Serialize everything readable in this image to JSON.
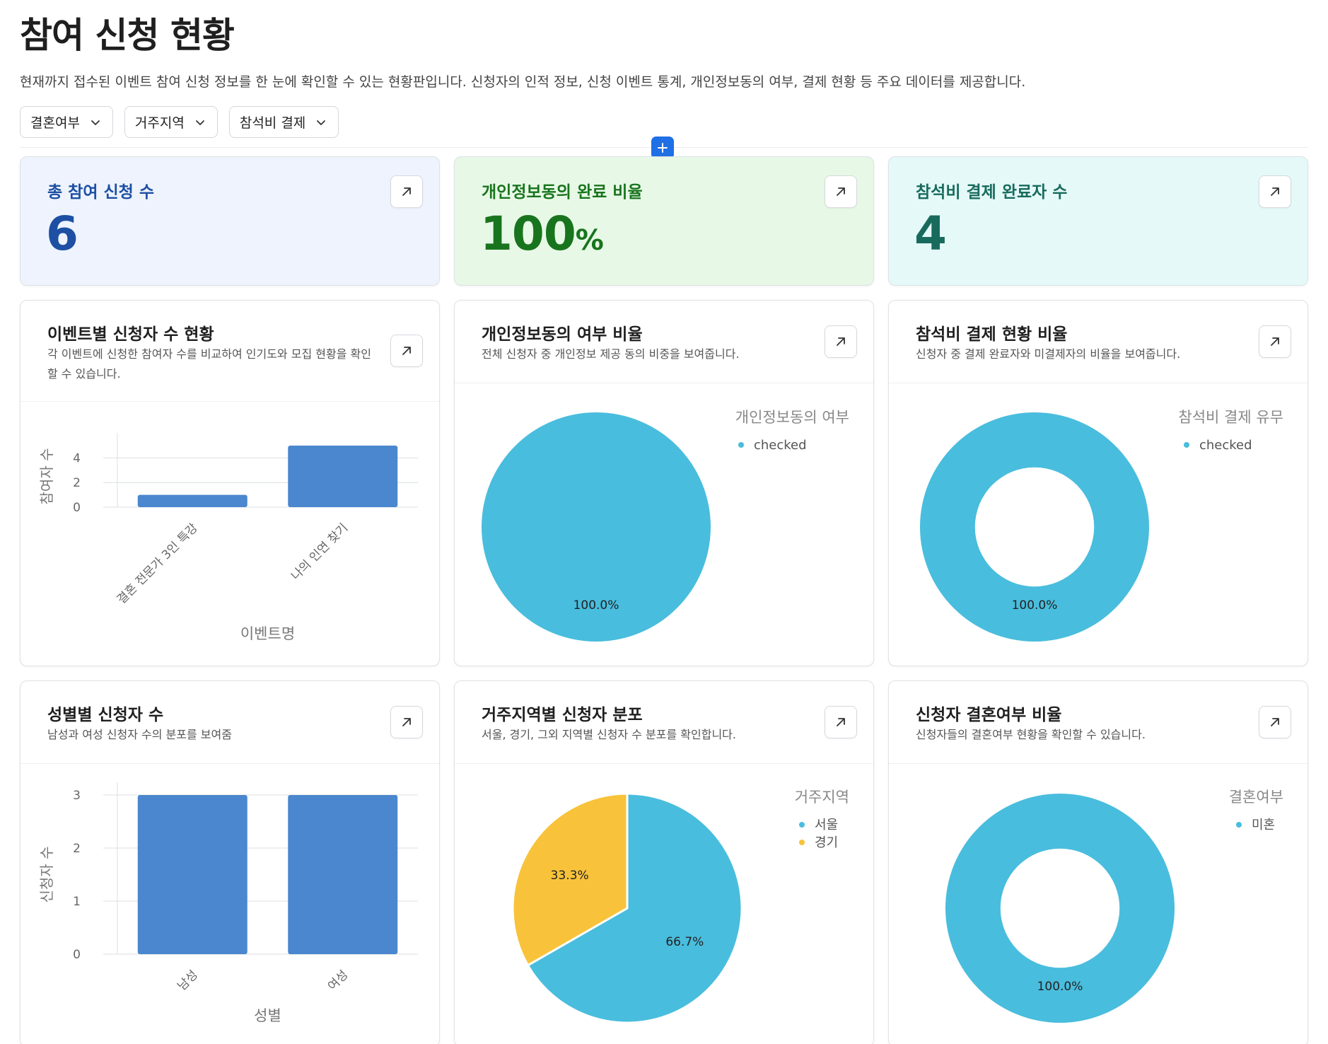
{
  "page": {
    "title": "참여 신청 현황",
    "description": "현재까지 접수된 이벤트 참여 신청 정보를 한 눈에 확인할 수 있는 현황판입니다. 신청자의 인적 정보, 신청 이벤트 통계, 개인정보동의 여부, 결제 현황 등 주요 데이터를 제공합니다."
  },
  "filters": [
    {
      "label": "결혼여부"
    },
    {
      "label": "거주지역"
    },
    {
      "label": "참석비 결제"
    }
  ],
  "add_button": {
    "label": "+"
  },
  "kpis": [
    {
      "title": "총 참여 신청 수",
      "value": "6",
      "unit": "",
      "color": "#1d4fa3",
      "bg": "#eef3fd"
    },
    {
      "title": "개인정보동의 완료 비율",
      "value": "100",
      "unit": "%",
      "color": "#19741e",
      "bg": "#e7f9e6"
    },
    {
      "title": "참석비 결제 완료자 수",
      "value": "4",
      "unit": "",
      "color": "#186b5c",
      "bg": "#e5f9f9"
    }
  ],
  "cards": {
    "events": {
      "title": "이벤트별 신청자 수 현황",
      "subtitle_line1": "각 이벤트에 신청한 참여자 수를 비교하여 인기도와 모집 현황을 확인",
      "subtitle_line2": "할 수 있습니다."
    },
    "privacy": {
      "title": "개인정보동의 여부 비율",
      "subtitle": "전체 신청자 중 개인정보 제공 동의 비중을 보여줍니다."
    },
    "payment": {
      "title": "참석비 결제 현황 비율",
      "subtitle": "신청자 중 결제 완료자와 미결제자의 비율을 보여줍니다."
    },
    "gender": {
      "title": "성별별 신청자 수",
      "subtitle": "남성과 여성 신청자 수의 분포를 보여줌"
    },
    "region": {
      "title": "거주지역별 신청자 분포",
      "subtitle": "서울, 경기, 그외 지역별 신청자 수 분포를 확인합니다."
    },
    "marital": {
      "title": "신청자 결혼여부 비율",
      "subtitle": "신청자들의 결혼여부 현황을 확인할 수 있습니다."
    }
  },
  "chart_data": [
    {
      "type": "bar",
      "id": "events",
      "categories": [
        "결혼 전문가 3인 특강",
        "나의 인연 찾기"
      ],
      "values": [
        1,
        5
      ],
      "ylabel": "참여자 수",
      "xlabel": "이벤트명",
      "ylim": [
        0,
        5
      ],
      "yticks": [
        0,
        2,
        4
      ],
      "color": "#4a87ce",
      "grid": true
    },
    {
      "type": "pie",
      "id": "privacy",
      "legend_title": "개인정보동의 여부",
      "labels": [
        "checked"
      ],
      "values": [
        100
      ],
      "percent_labels": [
        "100.0%"
      ],
      "colors": [
        "#49bddd"
      ],
      "legend": "top-right"
    },
    {
      "type": "pie",
      "id": "payment",
      "donut": true,
      "legend_title": "참석비 결제 유무",
      "labels": [
        "checked"
      ],
      "values": [
        100
      ],
      "percent_labels": [
        "100.0%"
      ],
      "colors": [
        "#49bddd"
      ],
      "legend": "top-right"
    },
    {
      "type": "bar",
      "id": "gender",
      "categories": [
        "남성",
        "여성"
      ],
      "values": [
        3,
        3
      ],
      "ylabel": "신청자 수",
      "xlabel": "성별",
      "ylim": [
        0,
        3
      ],
      "yticks": [
        0,
        1,
        2,
        3
      ],
      "color": "#4a87ce",
      "grid": true
    },
    {
      "type": "pie",
      "id": "region",
      "legend_title": "거주지역",
      "labels": [
        "서울",
        "경기"
      ],
      "values": [
        66.7,
        33.3
      ],
      "percent_labels": [
        "66.7%",
        "33.3%"
      ],
      "colors": [
        "#49bddd",
        "#f8c33a"
      ],
      "legend": "top-right"
    },
    {
      "type": "pie",
      "id": "marital",
      "donut": true,
      "legend_title": "결혼여부",
      "labels": [
        "미혼"
      ],
      "values": [
        100
      ],
      "percent_labels": [
        "100.0%"
      ],
      "colors": [
        "#49bddd"
      ],
      "legend": "top-right"
    }
  ]
}
